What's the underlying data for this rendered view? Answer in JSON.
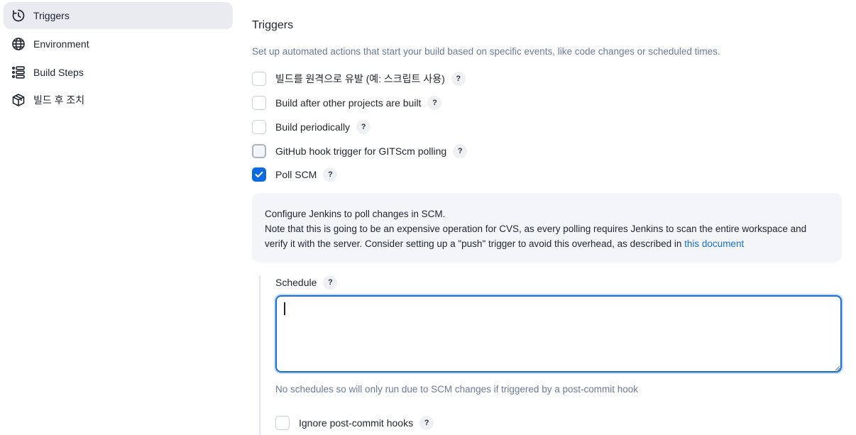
{
  "sidebar": {
    "items": [
      {
        "label": "Triggers",
        "icon": "clock-icon",
        "active": true
      },
      {
        "label": "Environment",
        "icon": "globe-icon",
        "active": false
      },
      {
        "label": "Build Steps",
        "icon": "list-icon",
        "active": false
      },
      {
        "label": "빌드 후 조치",
        "icon": "package-icon",
        "active": false
      }
    ]
  },
  "main": {
    "title": "Triggers",
    "description": "Set up automated actions that start your build based on specific events, like code changes or scheduled times.",
    "options": [
      {
        "label": "빌드를 원격으로 유발 (예: 스크립트 사용)",
        "checked": false
      },
      {
        "label": "Build after other projects are built",
        "checked": false
      },
      {
        "label": "Build periodically",
        "checked": false
      },
      {
        "label": "GitHub hook trigger for GITScm polling",
        "checked": false
      },
      {
        "label": "Poll SCM",
        "checked": true
      }
    ],
    "help_glyph": "?",
    "info": {
      "line1": "Configure Jenkins to poll changes in SCM.",
      "line2": "Note that this is going to be an expensive operation for CVS, as every polling requires Jenkins to scan the entire workspace and verify it with the server. Consider setting up a \"push\" trigger to avoid this overhead, as described in",
      "link": "this document"
    },
    "schedule": {
      "label": "Schedule",
      "value": "",
      "hint": "No schedules so will only run due to SCM changes if triggered by a post-commit hook"
    },
    "ignore_hooks": {
      "label": "Ignore post-commit hooks",
      "checked": false
    }
  },
  "colors": {
    "accent": "#0b6bde",
    "link": "#1a6dcc",
    "muted_text": "#6a7a96",
    "active_bg": "#e9ebf1",
    "info_bg": "#f3f5f8"
  }
}
